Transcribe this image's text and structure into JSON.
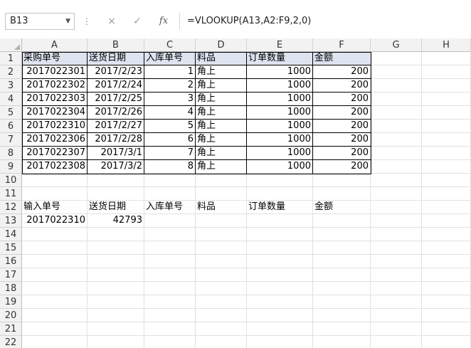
{
  "formula_bar": {
    "name_box": "B13",
    "cancel_icon": "×",
    "enter_icon": "✓",
    "function_label": "fx",
    "formula": "=VLOOKUP(A13,A2:F9,2,0)"
  },
  "columns": [
    "A",
    "B",
    "C",
    "D",
    "E",
    "F",
    "G",
    "H"
  ],
  "rows": [
    "1",
    "2",
    "3",
    "4",
    "5",
    "6",
    "7",
    "8",
    "9",
    "10",
    "11",
    "12",
    "13",
    "14",
    "15",
    "16",
    "17",
    "18",
    "19",
    "20",
    "21",
    "22"
  ],
  "table": {
    "headers": [
      "采购单号",
      "送货日期",
      "入库单号",
      "料品",
      "订单数量",
      "金额"
    ],
    "data": [
      [
        "2017022301",
        "2017/2/23",
        "1",
        "角上",
        "1000",
        "200"
      ],
      [
        "2017022302",
        "2017/2/24",
        "2",
        "角上",
        "1000",
        "200"
      ],
      [
        "2017022303",
        "2017/2/25",
        "3",
        "角上",
        "1000",
        "200"
      ],
      [
        "2017022304",
        "2017/2/26",
        "4",
        "角上",
        "1000",
        "200"
      ],
      [
        "2017022310",
        "2017/2/27",
        "5",
        "角上",
        "1000",
        "200"
      ],
      [
        "2017022306",
        "2017/2/28",
        "6",
        "角上",
        "1000",
        "200"
      ],
      [
        "2017022307",
        "2017/3/1",
        "7",
        "角上",
        "1000",
        "200"
      ],
      [
        "2017022308",
        "2017/3/2",
        "8",
        "角上",
        "1000",
        "200"
      ]
    ]
  },
  "lookup": {
    "headers": [
      "输入单号",
      "送货日期",
      "入库单号",
      "料品",
      "订单数量",
      "金额"
    ],
    "values": [
      "2017022310",
      "42793"
    ]
  }
}
